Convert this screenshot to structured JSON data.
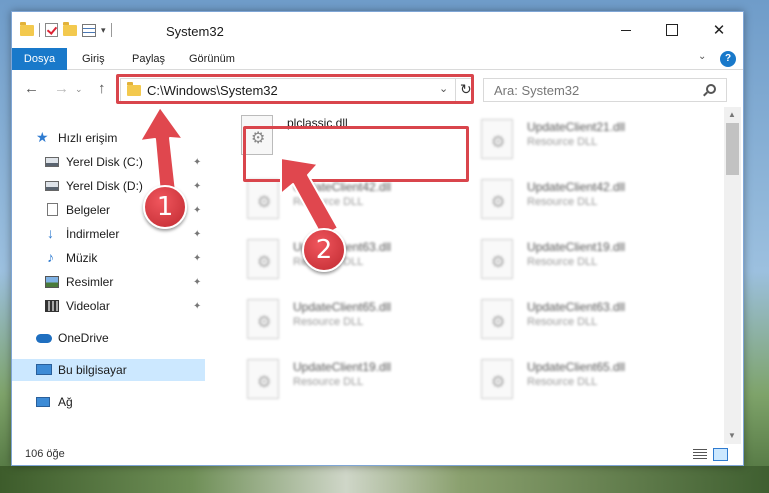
{
  "window": {
    "title": "System32",
    "controls": {
      "minimize": "",
      "maximize": "",
      "close": "✕"
    }
  },
  "ribbon": {
    "tabs": [
      "Dosya",
      "Giriş",
      "Paylaş",
      "Görünüm"
    ],
    "expand_icon": "⌄",
    "help_label": "?"
  },
  "navigation": {
    "back": "←",
    "forward": "→",
    "recent": "⌄",
    "up": "↑",
    "address": "C:\\Windows\\System32",
    "search_placeholder": "Ara: System32"
  },
  "sidebar": {
    "items": [
      {
        "label": "Hızlı erişim",
        "icon": "star-icon",
        "pinned": false
      },
      {
        "label": "Yerel Disk (C:)",
        "icon": "disk-icon",
        "pinned": true
      },
      {
        "label": "Yerel Disk (D:)",
        "icon": "disk-icon",
        "pinned": true
      },
      {
        "label": "Belgeler",
        "icon": "document-icon",
        "pinned": true
      },
      {
        "label": "İndirmeler",
        "icon": "download-icon",
        "pinned": true
      },
      {
        "label": "Müzik",
        "icon": "music-icon",
        "pinned": true
      },
      {
        "label": "Resimler",
        "icon": "pictures-icon",
        "pinned": true
      },
      {
        "label": "Videolar",
        "icon": "video-icon",
        "pinned": true
      },
      {
        "label": "OneDrive",
        "icon": "cloud-icon",
        "pinned": false
      },
      {
        "label": "Bu bilgisayar",
        "icon": "computer-icon",
        "pinned": false,
        "selected": true
      },
      {
        "label": "Ağ",
        "icon": "network-icon",
        "pinned": false
      }
    ],
    "pin_glyph": "📌"
  },
  "files": [
    {
      "name": "plclassic.dll",
      "type": "",
      "highlighted": true
    },
    {
      "name": "UpdateClient21.dll",
      "type": "Resource DLL"
    },
    {
      "name": "UpdateClient42.dll",
      "type": "Resource DLL"
    },
    {
      "name": "UpdateClient42.dll",
      "type": "Resource DLL"
    },
    {
      "name": "UpdateClient63.dll",
      "type": "Resource DLL"
    },
    {
      "name": "UpdateClient19.dll",
      "type": "Resource DLL"
    },
    {
      "name": "UpdateClient65.dll",
      "type": "Resource DLL"
    },
    {
      "name": "UpdateClient63.dll",
      "type": "Resource DLL"
    },
    {
      "name": "UpdateClient19.dll",
      "type": "Resource DLL"
    },
    {
      "name": "UpdateClient65.dll",
      "type": "Resource DLL"
    }
  ],
  "status": {
    "item_count": "106 öğe"
  },
  "annotations": {
    "step1": "1",
    "step2": "2",
    "highlight_color": "#d9454c"
  },
  "colors": {
    "accent": "#1979ca",
    "selection": "#cce8ff"
  }
}
